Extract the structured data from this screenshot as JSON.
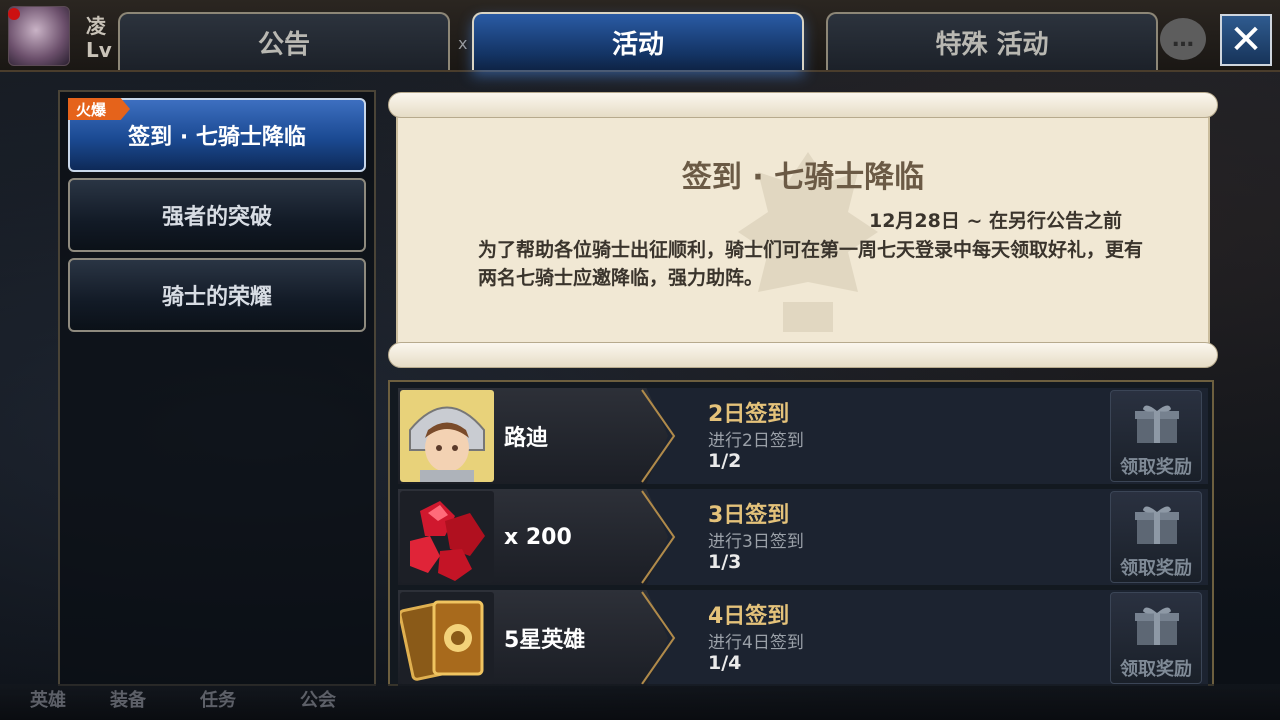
{
  "player": {
    "name": "凌",
    "level_label": "Lv"
  },
  "tabs": [
    {
      "label": "公告"
    },
    {
      "label": "活动"
    },
    {
      "label": "特殊 活动"
    }
  ],
  "tab_divider": "x",
  "chat_icon_glyph": "…",
  "close_glyph": "✕",
  "sidebar": {
    "items": [
      {
        "label": "签到 · 七骑士降临",
        "badge": "火爆"
      },
      {
        "label": "强者的突破"
      },
      {
        "label": "骑士的荣耀"
      }
    ]
  },
  "event": {
    "title": "签到 · 七骑士降临",
    "date": "12月28日 ~ 在另行公告之前",
    "description": "为了帮助各位骑士出征顺利，骑士们可在第一周七天登录中每天领取好礼，更有两名七骑士应邀降临，强力助阵。"
  },
  "rewards": [
    {
      "name": "路迪",
      "title": "2日签到",
      "subtitle": "进行2日签到",
      "progress": "1/2",
      "claim_label": "领取奖励",
      "icon": "knight-portrait-icon"
    },
    {
      "name": "x 200",
      "title": "3日签到",
      "subtitle": "进行3日签到",
      "progress": "1/3",
      "claim_label": "领取奖励",
      "icon": "ruby-gems-icon"
    },
    {
      "name": "5星英雄",
      "title": "4日签到",
      "subtitle": "进行4日签到",
      "progress": "1/4",
      "claim_label": "领取奖励",
      "icon": "hero-cards-icon"
    }
  ],
  "bottom_nav": [
    "英雄",
    "装备",
    "任务",
    "公会"
  ],
  "colors": {
    "accent_blue": "#1b4a93",
    "gold_text": "#e4c27a",
    "badge_orange": "#e5631b",
    "parchment": "#f1e8d4"
  }
}
